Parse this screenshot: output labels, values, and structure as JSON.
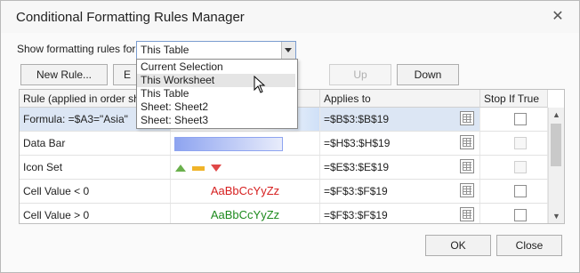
{
  "window": {
    "title": "Conditional Formatting Rules Manager"
  },
  "filter": {
    "label": "Show formatting rules for:",
    "value": "This Table"
  },
  "dropdown": {
    "options": [
      "Current Selection",
      "This Worksheet",
      "This Table",
      "Sheet: Sheet2",
      "Sheet: Sheet3"
    ],
    "highlighted": "This Worksheet"
  },
  "toolbar": {
    "new_rule": "New Rule...",
    "edit_partial": "E",
    "up": "Up",
    "down": "Down"
  },
  "table": {
    "headers": [
      "Rule (applied in order show",
      "",
      "Applies to",
      "Stop If True"
    ],
    "rows": [
      {
        "rule": "Formula: =$A3=\"Asia\"",
        "preview": "",
        "applies": "=$B$3:$B$19",
        "stop_enabled": true
      },
      {
        "rule": "Data Bar",
        "preview": "",
        "applies": "=$H$3:$H$19",
        "stop_enabled": false
      },
      {
        "rule": "Icon Set",
        "preview": "",
        "applies": "=$E$3:$E$19",
        "stop_enabled": false
      },
      {
        "rule": "Cell Value < 0",
        "preview": "AaBbCcYyZz",
        "applies": "=$F$3:$F$19",
        "stop_enabled": true
      },
      {
        "rule": "Cell Value > 0",
        "preview": "AaBbCcYyZz",
        "applies": "=$F$3:$F$19",
        "stop_enabled": true
      }
    ]
  },
  "footer": {
    "ok": "OK",
    "close": "Close"
  },
  "colors": {
    "negative_text": "#d62020",
    "positive_text": "#1e8a1e",
    "selection": "#dce6f4",
    "databar": "#8ea4f0"
  },
  "icons": {
    "close": "close-icon",
    "picker": "range-picker-icon",
    "cursor": "mouse-pointer-icon"
  }
}
